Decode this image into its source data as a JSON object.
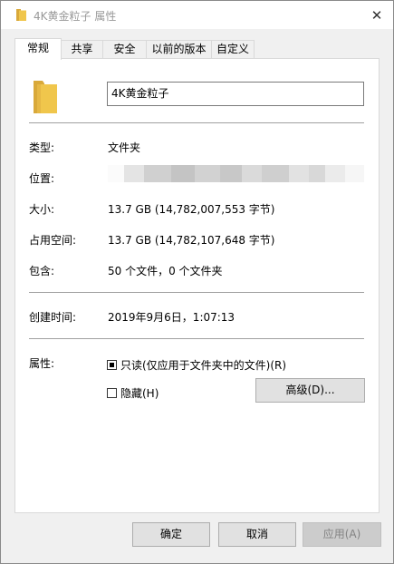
{
  "window": {
    "title": "4K黄金粒子 属性",
    "close_glyph": "✕"
  },
  "tabs": [
    {
      "label": "常规",
      "active": true
    },
    {
      "label": "共享",
      "active": false
    },
    {
      "label": "安全",
      "active": false
    },
    {
      "label": "以前的版本",
      "active": false
    },
    {
      "label": "自定义",
      "active": false
    }
  ],
  "general": {
    "folder_name": "4K黄金粒子",
    "type_label": "类型:",
    "type_value": "文件夹",
    "location_label": "位置:",
    "size_label": "大小:",
    "size_value": "13.7 GB (14,782,007,553 字节)",
    "disk_size_label": "占用空间:",
    "disk_size_value": "13.7 GB (14,782,107,648 字节)",
    "contains_label": "包含:",
    "contains_value": "50 个文件，0 个文件夹",
    "created_label": "创建时间:",
    "created_value": "2019年9月6日，1:07:13",
    "attributes_label": "属性:",
    "readonly_label": "只读(仅应用于文件夹中的文件)(R)",
    "hidden_label": "隐藏(H)",
    "advanced_button": "高级(D)..."
  },
  "footer": {
    "ok": "确定",
    "cancel": "取消",
    "apply": "应用(A)"
  },
  "colors": {
    "folder": "#f0c64c",
    "folder_dark": "#d9a93a"
  }
}
